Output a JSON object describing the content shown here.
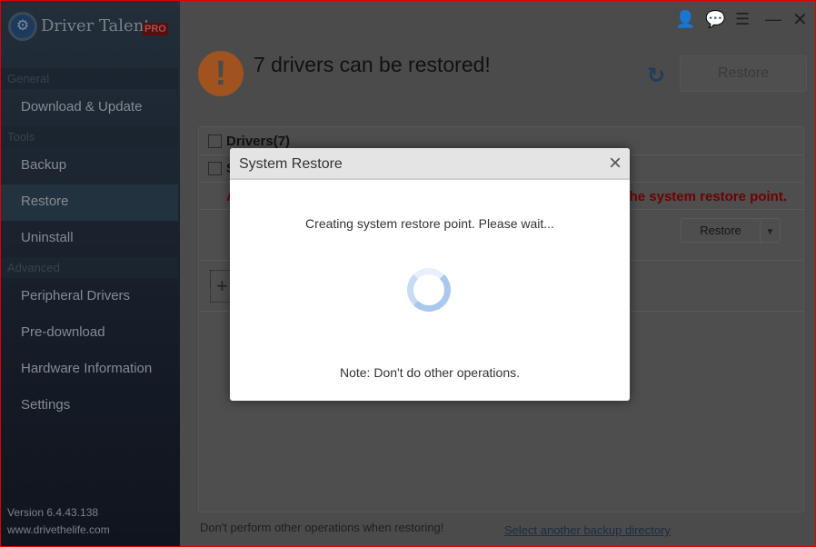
{
  "app": {
    "name": "Driver Talent",
    "badge": "PRO",
    "logo_icon": "gear-icon"
  },
  "sidebar": {
    "sections": [
      "General",
      "Tools",
      "Advanced"
    ],
    "items": [
      "Download & Update",
      "Backup",
      "Restore",
      "Uninstall",
      "Peripheral Drivers",
      "Pre-download",
      "Hardware Information",
      "Settings"
    ],
    "selected": "Restore",
    "version": "Version 6.4.43.138",
    "website": "www.drivethelife.com"
  },
  "header": {
    "title": "7 drivers can be restored!",
    "restore_button": "Restore",
    "warning_icon": "exclamation-icon"
  },
  "list": {
    "drivers_header": "Drivers(7)",
    "row2_partial": "S",
    "warning_left": "A",
    "warning_text": "the system restore point.",
    "restore_button": "Restore"
  },
  "footer": {
    "note": "Don't perform other operations when restoring!",
    "link": "Select another backup directory"
  },
  "dialog": {
    "title": "System Restore",
    "message": "Creating system restore point. Please wait...",
    "note": "Note: Don't do other operations."
  },
  "colors": {
    "accent": "#1f3d5c",
    "warning": "#a0531f",
    "alert_text": "#700000",
    "border": "#e00000"
  }
}
